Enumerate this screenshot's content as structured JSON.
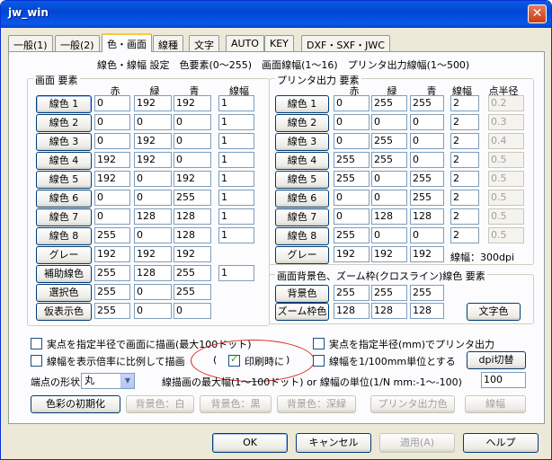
{
  "window": {
    "title": "jw_win",
    "close_glyph": "✕"
  },
  "tabs": [
    {
      "label": "一般(1)"
    },
    {
      "label": "一般(2)"
    },
    {
      "label": "色・画面"
    },
    {
      "label": "線種"
    },
    {
      "label": "文字"
    },
    {
      "label": "AUTO"
    },
    {
      "label": "KEY"
    },
    {
      "label": "DXF・SXF・JWC"
    }
  ],
  "header_line": "線色・線幅 設定　色要素(0～255)　画面線幅(1～16)　プリンタ出力線幅(1～500)",
  "screen_group": {
    "title": "画面 要素",
    "col_headers": [
      "赤",
      "緑",
      "青",
      "線幅"
    ],
    "rows": [
      {
        "label": "線色 1",
        "r": "0",
        "g": "192",
        "b": "192",
        "w": "1"
      },
      {
        "label": "線色 2",
        "r": "0",
        "g": "0",
        "b": "0",
        "w": "1"
      },
      {
        "label": "線色 3",
        "r": "0",
        "g": "192",
        "b": "0",
        "w": "1"
      },
      {
        "label": "線色 4",
        "r": "192",
        "g": "192",
        "b": "0",
        "w": "1"
      },
      {
        "label": "線色 5",
        "r": "192",
        "g": "0",
        "b": "192",
        "w": "1"
      },
      {
        "label": "線色 6",
        "r": "0",
        "g": "0",
        "b": "255",
        "w": "1"
      },
      {
        "label": "線色 7",
        "r": "0",
        "g": "128",
        "b": "128",
        "w": "1"
      },
      {
        "label": "線色 8",
        "r": "255",
        "g": "0",
        "b": "128",
        "w": "1"
      },
      {
        "label": "グレー",
        "r": "192",
        "g": "192",
        "b": "192",
        "w": ""
      },
      {
        "label": "補助線色",
        "r": "255",
        "g": "128",
        "b": "255",
        "w": "1"
      },
      {
        "label": "選択色",
        "r": "255",
        "g": "0",
        "b": "255",
        "w": ""
      },
      {
        "label": "仮表示色",
        "r": "255",
        "g": "0",
        "b": "0",
        "w": ""
      }
    ]
  },
  "printer_group": {
    "title": "プリンタ出力 要素",
    "col_headers": [
      "赤",
      "緑",
      "青",
      "線幅",
      "点半径"
    ],
    "rows": [
      {
        "label": "線色 1",
        "r": "0",
        "g": "255",
        "b": "255",
        "w": "2",
        "p": "0.2"
      },
      {
        "label": "線色 2",
        "r": "0",
        "g": "0",
        "b": "0",
        "w": "2",
        "p": "0.3"
      },
      {
        "label": "線色 3",
        "r": "0",
        "g": "255",
        "b": "0",
        "w": "2",
        "p": "0.4"
      },
      {
        "label": "線色 4",
        "r": "255",
        "g": "255",
        "b": "0",
        "w": "2",
        "p": "0.5"
      },
      {
        "label": "線色 5",
        "r": "255",
        "g": "0",
        "b": "255",
        "w": "2",
        "p": "0.5"
      },
      {
        "label": "線色 6",
        "r": "0",
        "g": "0",
        "b": "255",
        "w": "2",
        "p": "0.5"
      },
      {
        "label": "線色 7",
        "r": "0",
        "g": "128",
        "b": "128",
        "w": "2",
        "p": "0.5"
      },
      {
        "label": "線色 8",
        "r": "255",
        "g": "0",
        "b": "0",
        "w": "2",
        "p": "0.5"
      },
      {
        "label": "グレー",
        "r": "192",
        "g": "192",
        "b": "192"
      }
    ],
    "dpi_label": "線幅：300dpi"
  },
  "bg_group": {
    "title": "画面背景色、ズーム枠(クロスライン)線色 要素",
    "rows": [
      {
        "label": "背景色",
        "r": "255",
        "g": "255",
        "b": "255"
      },
      {
        "label": "ズーム枠色",
        "r": "128",
        "g": "128",
        "b": "128"
      }
    ],
    "text_color_button": "文字色"
  },
  "options": {
    "point_screen": "実点を指定半径で画面に描画(最大100ドット)",
    "point_printer": "実点を指定半径(mm)でプリンタ出力",
    "linewidth_scale": "線幅を表示倍率に比例して描画",
    "print_time_open": "(",
    "print_time": "印刷時に",
    "print_time_close": ")",
    "linewidth_unit": "線幅を1/100mm単位とする",
    "dpi_button": "dpi切替",
    "endpoint_label": "端点の形状",
    "endpoint_value": "丸",
    "max_width_label": "線描画の最大幅(1～100ドット) or 線幅の単位(1/N mm:-1～-100)",
    "max_width_value": "100"
  },
  "bottom_buttons": {
    "init": "色彩の初期化",
    "bg_white": "背景色：白",
    "bg_black": "背景色：黒",
    "bg_deep": "背景色：深緑",
    "printer_color": "プリンタ出力色",
    "linewidth": "線幅"
  },
  "dialog_buttons": {
    "ok": "OK",
    "cancel": "キャンセル",
    "apply": "適用(A)",
    "help": "ヘルプ"
  }
}
